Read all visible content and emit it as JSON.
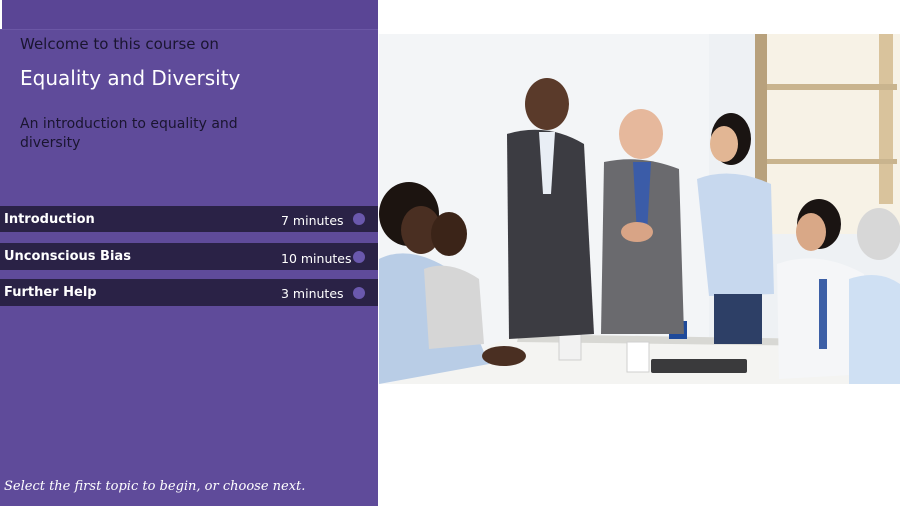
{
  "course": {
    "welcome": "Welcome to this course on",
    "title": "Equality and Diversity",
    "subtitle": "An introduction to equality and diversity"
  },
  "topics": [
    {
      "label": "Introduction",
      "duration": "7 minutes"
    },
    {
      "label": "Unconscious Bias",
      "duration": "10 minutes"
    },
    {
      "label": "Further Help",
      "duration": "3 minutes"
    }
  ],
  "hint": "Select the first topic to begin, or choose next.",
  "colors": {
    "panel": "#5f4b9a",
    "topic_bar": "#2a2246",
    "dot": "#6a58ad"
  },
  "photo": {
    "icon": "business-meeting-handshake-photo"
  }
}
